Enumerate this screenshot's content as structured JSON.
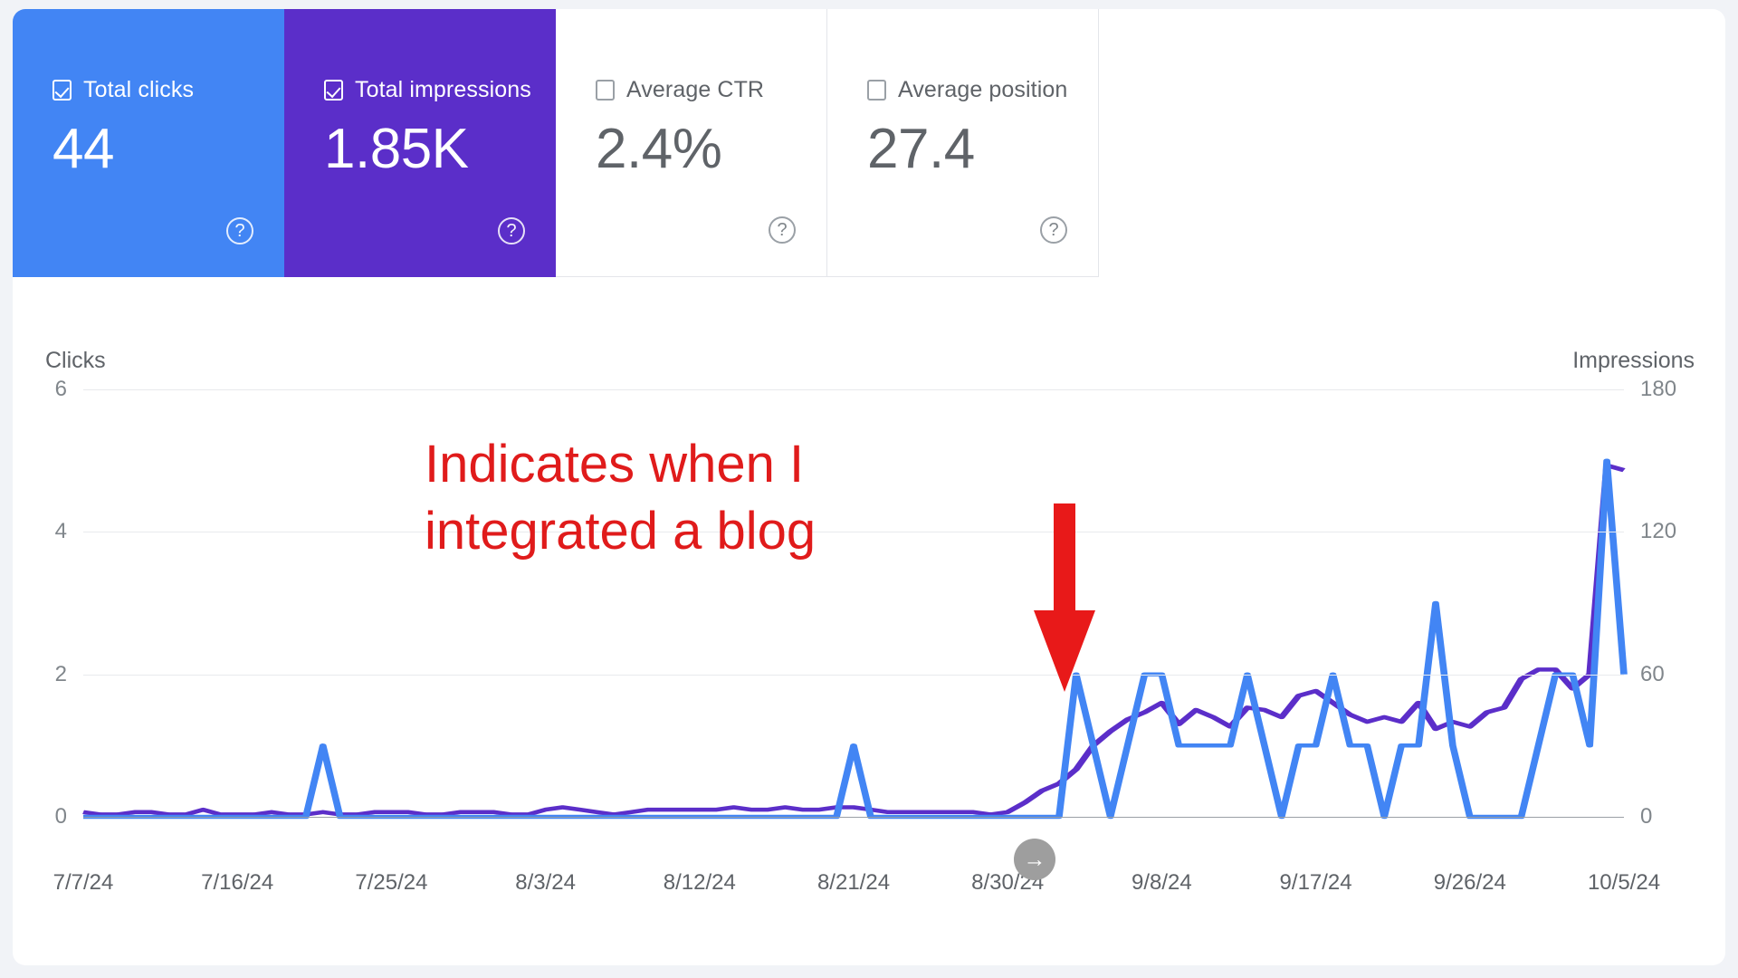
{
  "metrics": [
    {
      "id": "total-clicks",
      "label": "Total clicks",
      "value": "44",
      "checked": true,
      "selected": "clicks",
      "help": "?"
    },
    {
      "id": "total-impressions",
      "label": "Total impressions",
      "value": "1.85K",
      "checked": true,
      "selected": "impr",
      "help": "?"
    },
    {
      "id": "average-ctr",
      "label": "Average CTR",
      "value": "2.4%",
      "checked": false,
      "selected": "none",
      "help": "?"
    },
    {
      "id": "average-position",
      "label": "Average position",
      "value": "27.4",
      "checked": false,
      "selected": "none",
      "help": "?"
    }
  ],
  "annotation": {
    "text": "Indicates when I\nintegrated a blog",
    "color": "#e01b1b"
  },
  "expand_button": {
    "glyph": "→"
  },
  "colors": {
    "clicks": "#4285f4",
    "impressions": "#5b2ec9",
    "annotation": "#e01b1b",
    "grid": "#e8eaed"
  },
  "chart_data": {
    "type": "line",
    "title": "",
    "xlabel": "",
    "ylabel": "Clicks",
    "y2label": "Impressions",
    "ylim": [
      0,
      6
    ],
    "y2lim": [
      0,
      180
    ],
    "yticks": [
      6,
      4,
      2,
      0
    ],
    "y2ticks": [
      180,
      120,
      60,
      0
    ],
    "grid": true,
    "legend": "top",
    "x_tick_labels": [
      "7/7/24",
      "7/16/24",
      "7/25/24",
      "8/3/24",
      "8/12/24",
      "8/21/24",
      "8/30/24",
      "9/8/24",
      "9/17/24",
      "9/26/24",
      "10/5/24"
    ],
    "x_tick_index": [
      0,
      9,
      18,
      27,
      36,
      45,
      54,
      63,
      72,
      81,
      90
    ],
    "series": [
      {
        "name": "Clicks",
        "color": "#4285f4",
        "axis": "left",
        "values": [
          0,
          0,
          0,
          0,
          0,
          0,
          0,
          0,
          0,
          0,
          0,
          0,
          0,
          0,
          1,
          0,
          0,
          0,
          0,
          0,
          0,
          0,
          0,
          0,
          0,
          0,
          0,
          0,
          0,
          0,
          0,
          0,
          0,
          0,
          0,
          0,
          0,
          0,
          0,
          0,
          0,
          0,
          0,
          0,
          0,
          1,
          0,
          0,
          0,
          0,
          0,
          0,
          0,
          0,
          0,
          0,
          0,
          0,
          2,
          1,
          0,
          1,
          2,
          2,
          1,
          1,
          1,
          1,
          2,
          1,
          0,
          1,
          1,
          2,
          1,
          1,
          0,
          1,
          1,
          3,
          1,
          0,
          0,
          0,
          0,
          1,
          2,
          2,
          1,
          5,
          2
        ]
      },
      {
        "name": "Impressions",
        "color": "#5b2ec9",
        "axis": "right",
        "values": [
          2,
          1,
          1,
          2,
          2,
          1,
          1,
          3,
          1,
          1,
          1,
          2,
          1,
          1,
          2,
          1,
          1,
          2,
          2,
          2,
          1,
          1,
          2,
          2,
          2,
          1,
          1,
          3,
          4,
          3,
          2,
          1,
          2,
          3,
          3,
          3,
          3,
          3,
          4,
          3,
          3,
          4,
          3,
          3,
          4,
          4,
          3,
          2,
          2,
          2,
          2,
          2,
          2,
          1,
          2,
          6,
          11,
          14,
          20,
          30,
          36,
          41,
          44,
          48,
          39,
          45,
          42,
          38,
          46,
          45,
          42,
          51,
          53,
          48,
          43,
          40,
          42,
          40,
          48,
          37,
          40,
          38,
          44,
          46,
          58,
          62,
          62,
          54,
          60,
          148,
          146
        ]
      }
    ]
  }
}
